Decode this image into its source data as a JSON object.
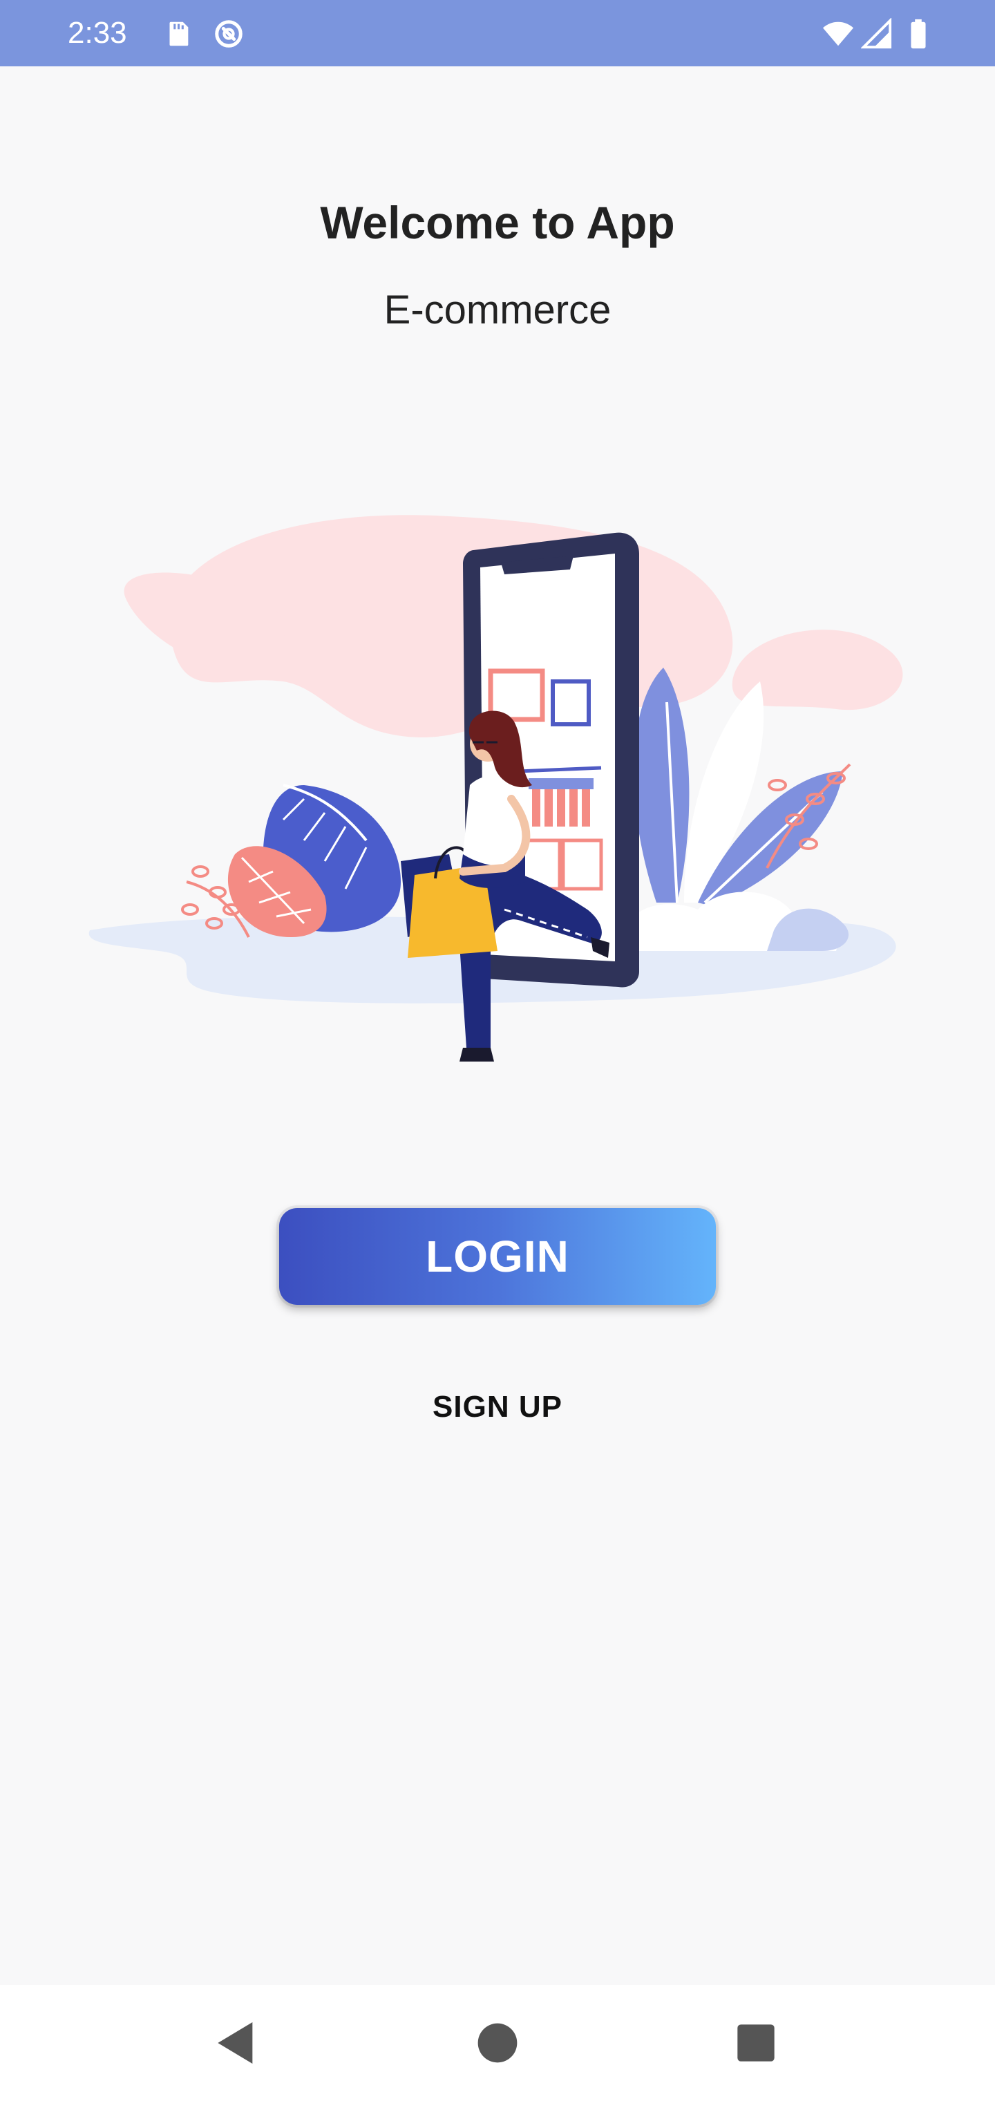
{
  "status_bar": {
    "time": "2:33",
    "icons": [
      "sd-card-icon",
      "data-saver-icon",
      "wifi-icon",
      "signal-icon",
      "battery-icon"
    ],
    "background": "#7b95dd"
  },
  "main": {
    "title": "Welcome to App",
    "subtitle": "E-commerce",
    "illustration": "shopping-woman-phone-illustration"
  },
  "actions": {
    "login_label": "LOGIN",
    "signup_label": "SIGN UP",
    "login_gradient": [
      "#3c4fc0",
      "#64b4fb"
    ]
  },
  "nav_bar": {
    "icons": [
      "back-icon",
      "home-icon",
      "recents-icon"
    ]
  }
}
